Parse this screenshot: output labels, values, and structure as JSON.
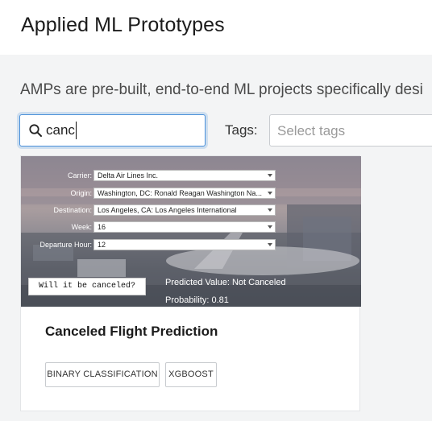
{
  "header": {
    "title": "Applied ML Prototypes"
  },
  "main": {
    "description": "AMPs are pre-built, end-to-end ML projects specifically desi",
    "search": {
      "value": "canc",
      "icon": "search-icon"
    },
    "tags": {
      "label": "Tags:",
      "placeholder": "Select tags"
    }
  },
  "card": {
    "image": {
      "form": [
        {
          "label": "Carrier:",
          "value": "Delta Air Lines Inc."
        },
        {
          "label": "Origin:",
          "value": "Washington, DC: Ronald Reagan Washington Na..."
        },
        {
          "label": "Destination:",
          "value": "Los Angeles, CA: Los Angeles International"
        },
        {
          "label": "Week:",
          "value": "16"
        },
        {
          "label": "Departure Hour:",
          "value": "12"
        }
      ],
      "button_label": "Will it be canceled?",
      "predicted_value": "Predicted Value: Not Canceled",
      "probability": "Probability: 0.81"
    },
    "title": "Canceled Flight Prediction",
    "tags": [
      "BINARY CLASSIFICATION",
      "XGBOOST"
    ]
  },
  "colors": {
    "accent": "#4a90d9",
    "page_bg": "#f3f4f5",
    "card_bg": "#ffffff"
  }
}
